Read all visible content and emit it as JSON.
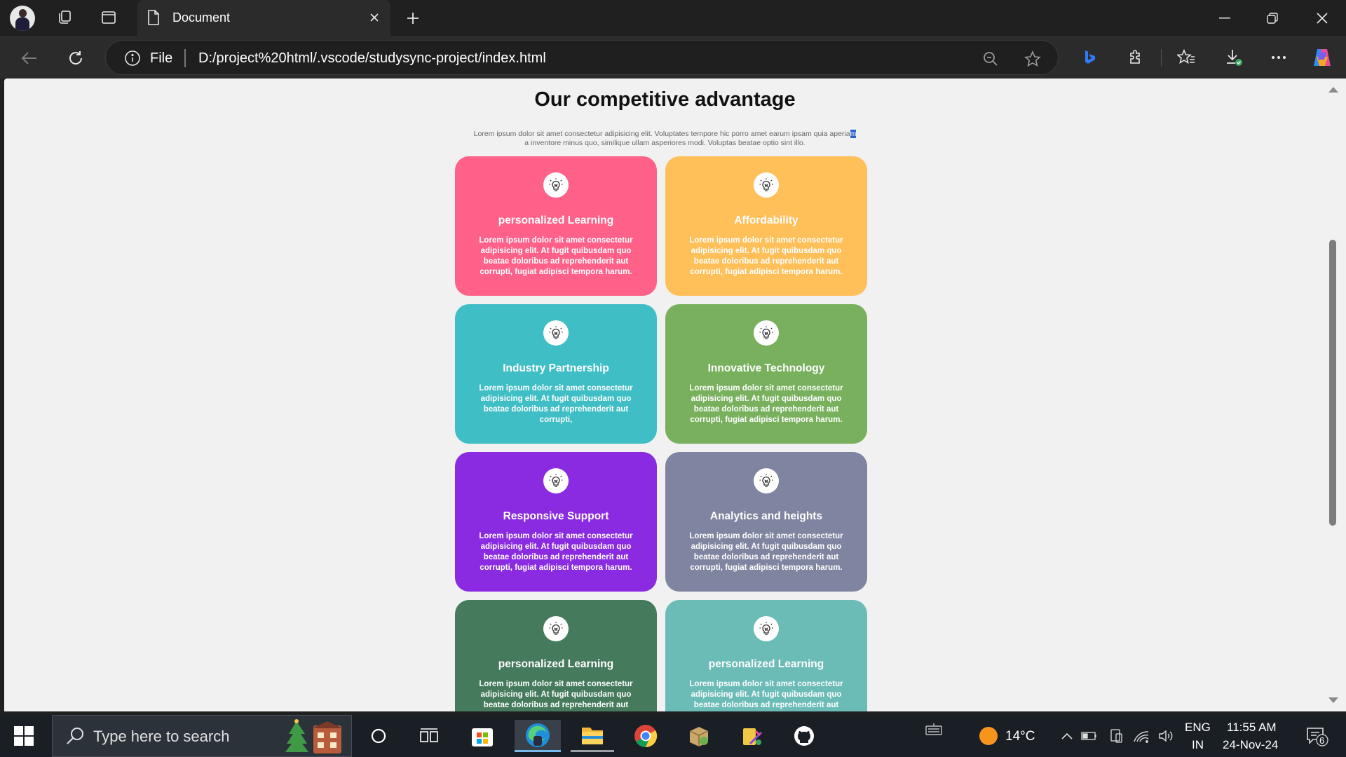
{
  "browser": {
    "tab_title": "Document",
    "omnibox_scheme": "File",
    "url": "D:/project%20html/.vscode/studysync-project/index.html"
  },
  "page": {
    "title": "Our competitive advantage",
    "description": "Lorem ipsum dolor sit amet consectetur adipisicing elit. Voluptates tempore hic porro amet earum ipsam quia aperia",
    "description_selected": "m",
    "description_line2": "a inventore minus quo, similique ullam asperiores modi. Voluptas beatae optio sint illo.",
    "cards": [
      {
        "title": "personalized Learning",
        "text": "Lorem ipsum dolor sit amet consectetur adipisicing elit. At fugit quibusdam quo beatae doloribus ad reprehenderit aut corrupti, fugiat adipisci tempora harum.",
        "color": "#ff6189"
      },
      {
        "title": "Affordability",
        "text": "Lorem ipsum dolor sit amet consectetur adipisicing elit. At fugit quibusdam quo beatae doloribus ad reprehenderit aut corrupti, fugiat adipisci tempora harum.",
        "color": "#ffbf59"
      },
      {
        "title": "Industry Partnership",
        "text": "Lorem ipsum dolor sit amet consectetur adipisicing elit. At fugit quibusdam quo beatae doloribus ad reprehenderit aut corrupti,",
        "color": "#3fbec5"
      },
      {
        "title": "Innovative Technology",
        "text": "Lorem ipsum dolor sit amet consectetur adipisicing elit. At fugit quibusdam quo beatae doloribus ad reprehenderit aut corrupti, fugiat adipisci tempora harum.",
        "color": "#78b05d"
      },
      {
        "title": "Responsive Support",
        "text": "Lorem ipsum dolor sit amet consectetur adipisicing elit. At fugit quibusdam quo beatae doloribus ad reprehenderit aut corrupti, fugiat adipisci tempora harum.",
        "color": "#8a2be2"
      },
      {
        "title": "Analytics and heights",
        "text": "Lorem ipsum dolor sit amet consectetur adipisicing elit. At fugit quibusdam quo beatae doloribus ad reprehenderit aut corrupti, fugiat adipisci tempora harum.",
        "color": "#7f84a0"
      },
      {
        "title": "personalized Learning",
        "text": "Lorem ipsum dolor sit amet consectetur adipisicing elit. At fugit quibusdam quo beatae doloribus ad reprehenderit aut corrupti, fugiat adipisci tempora harum.",
        "color": "#457a5c"
      },
      {
        "title": "personalized Learning",
        "text": "Lorem ipsum dolor sit amet consectetur adipisicing elit. At fugit quibusdam quo beatae doloribus ad reprehenderit aut corrupti, fugiat adipisci tempora harum.",
        "color": "#6bbbb7"
      }
    ]
  },
  "taskbar": {
    "search_placeholder": "Type here to search",
    "temperature": "14°C",
    "language": "ENG",
    "region": "IN",
    "time": "11:55 AM",
    "date": "24-Nov-24",
    "notification_count": "6"
  }
}
